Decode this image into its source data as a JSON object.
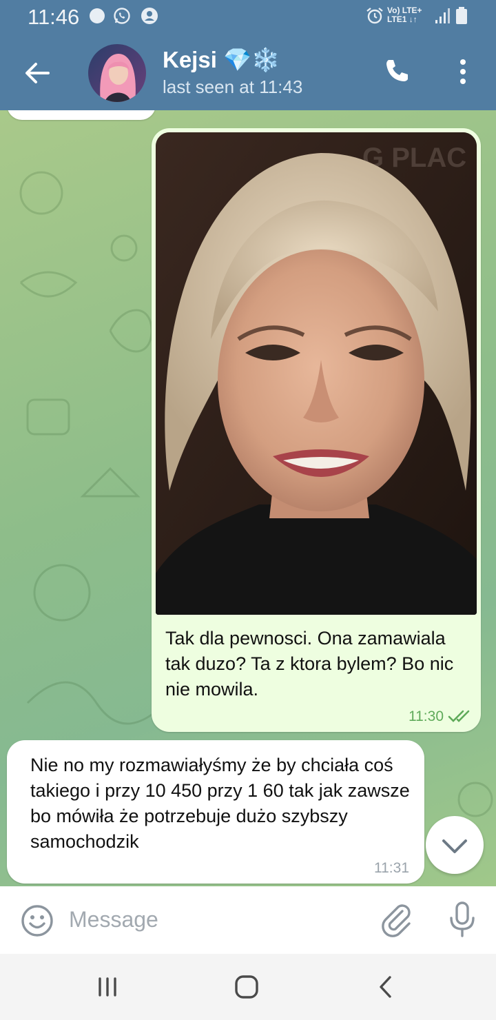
{
  "status_bar": {
    "time": "11:46",
    "network_label_line1": "Vo) LTE+",
    "network_label_line2": "LTE1 ↓↑",
    "icons": [
      "dot-icon",
      "whatsapp-icon",
      "account-icon",
      "alarm-icon",
      "signal-icon",
      "battery-icon"
    ]
  },
  "header": {
    "back_icon": "arrow-left-icon",
    "contact_name": "Kejsi 💎❄️",
    "last_seen": "last seen at 11:43",
    "call_icon": "phone-icon",
    "menu_icon": "more-vertical-icon"
  },
  "messages": [
    {
      "direction": "outgoing",
      "has_photo": true,
      "text": "Tak dla pewnosci. Ona zamawiala tak duzo? Ta z ktora bylem? Bo nic nie mowila.",
      "time": "11:30",
      "status": "read"
    },
    {
      "direction": "incoming",
      "text": "Nie no my rozmawiałyśmy że by chciała coś takiego i przy 10 450 przy 1 60 tak jak zawsze bo mówiła że potrzebuje dużo szybszy samochodzik",
      "time": "11:31"
    }
  ],
  "composer": {
    "placeholder": "Message",
    "emoji_icon": "smile-icon",
    "attach_icon": "paperclip-icon",
    "mic_icon": "microphone-icon"
  },
  "nav": {
    "icons": [
      "recent-apps-icon",
      "home-icon",
      "back-nav-icon"
    ]
  },
  "colors": {
    "header": "#517da2",
    "outgoing_bubble": "#eefee0",
    "incoming_bubble": "#ffffff",
    "read_check": "#5faa5a"
  }
}
